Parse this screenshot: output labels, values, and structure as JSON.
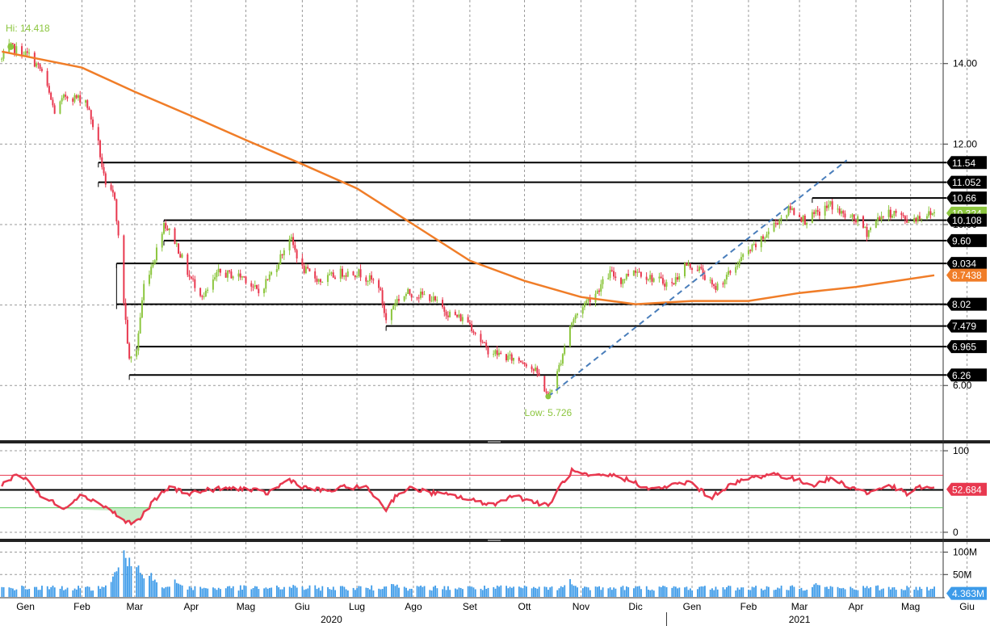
{
  "chart_data": [
    {
      "type": "candlestick",
      "panel": "price",
      "x_start": "2020-01-02",
      "x_end": "2021-05-28",
      "y_ticks": [
        "14.00",
        "12.00",
        "10.00",
        "8.00",
        "6.00"
      ],
      "ylim": [
        4.7,
        15.4
      ],
      "high": {
        "label": "Hi: 14.418",
        "date": "2020-01-06",
        "value": 14.418
      },
      "low": {
        "label": "Low: 5.726",
        "date": "2020-10-28",
        "value": 5.726
      },
      "path": [
        [
          "2020-01-02",
          14.1
        ],
        [
          "2020-01-06",
          14.42
        ],
        [
          "2020-01-17",
          14.2
        ],
        [
          "2020-01-24",
          13.8
        ],
        [
          "2020-01-31",
          12.8
        ],
        [
          "2020-02-06",
          13.2
        ],
        [
          "2020-02-17",
          13.1
        ],
        [
          "2020-02-24",
          12.0
        ],
        [
          "2020-02-28",
          10.9
        ],
        [
          "2020-03-04",
          10.7
        ],
        [
          "2020-03-09",
          8.1
        ],
        [
          "2020-03-12",
          6.6
        ],
        [
          "2020-03-16",
          6.9
        ],
        [
          "2020-03-20",
          8.5
        ],
        [
          "2020-03-26",
          9.2
        ],
        [
          "2020-03-31",
          10.05
        ],
        [
          "2020-04-06",
          9.6
        ],
        [
          "2020-04-14",
          8.7
        ],
        [
          "2020-04-22",
          8.2
        ],
        [
          "2020-04-30",
          8.8
        ],
        [
          "2020-05-14",
          8.7
        ],
        [
          "2020-05-22",
          8.3
        ],
        [
          "2020-06-01",
          9.0
        ],
        [
          "2020-06-08",
          9.7
        ],
        [
          "2020-06-15",
          8.9
        ],
        [
          "2020-06-25",
          8.6
        ],
        [
          "2020-07-06",
          8.8
        ],
        [
          "2020-07-16",
          8.8
        ],
        [
          "2020-07-27",
          8.5
        ],
        [
          "2020-07-31",
          7.6
        ],
        [
          "2020-08-05",
          8.1
        ],
        [
          "2020-08-12",
          8.3
        ],
        [
          "2020-08-24",
          8.2
        ],
        [
          "2020-09-03",
          7.8
        ],
        [
          "2020-09-14",
          7.6
        ],
        [
          "2020-09-24",
          6.9
        ],
        [
          "2020-10-05",
          6.7
        ],
        [
          "2020-10-15",
          6.6
        ],
        [
          "2020-10-22",
          6.3
        ],
        [
          "2020-10-28",
          5.73
        ],
        [
          "2020-11-02",
          6.3
        ],
        [
          "2020-11-09",
          7.5
        ],
        [
          "2020-11-16",
          8.0
        ],
        [
          "2020-11-23",
          8.3
        ],
        [
          "2020-12-01",
          8.8
        ],
        [
          "2020-12-07",
          8.6
        ],
        [
          "2020-12-14",
          8.9
        ],
        [
          "2020-12-22",
          8.7
        ],
        [
          "2021-01-04",
          8.5
        ],
        [
          "2021-01-11",
          9.0
        ],
        [
          "2021-01-19",
          8.9
        ],
        [
          "2021-01-27",
          8.4
        ],
        [
          "2021-02-03",
          8.7
        ],
        [
          "2021-02-12",
          9.2
        ],
        [
          "2021-02-22",
          9.6
        ],
        [
          "2021-03-01",
          10.0
        ],
        [
          "2021-03-10",
          10.4
        ],
        [
          "2021-03-18",
          10.1
        ],
        [
          "2021-03-26",
          10.3
        ],
        [
          "2021-04-01",
          10.5
        ],
        [
          "2021-04-09",
          10.2
        ],
        [
          "2021-04-16",
          10.1
        ],
        [
          "2021-04-21",
          9.8
        ],
        [
          "2021-04-28",
          10.2
        ],
        [
          "2021-05-06",
          10.3
        ],
        [
          "2021-05-13",
          10.1
        ],
        [
          "2021-05-20",
          10.2
        ],
        [
          "2021-05-28",
          10.3
        ]
      ],
      "moving_average": [
        [
          "2020-01-02",
          14.3
        ],
        [
          "2020-02-15",
          13.9
        ],
        [
          "2020-03-15",
          13.3
        ],
        [
          "2020-04-15",
          12.7
        ],
        [
          "2020-05-15",
          12.1
        ],
        [
          "2020-06-15",
          11.5
        ],
        [
          "2020-07-15",
          10.9
        ],
        [
          "2020-08-15",
          10.0
        ],
        [
          "2020-09-15",
          9.1
        ],
        [
          "2020-10-15",
          8.6
        ],
        [
          "2020-11-15",
          8.2
        ],
        [
          "2020-12-15",
          8.02
        ],
        [
          "2021-01-15",
          8.1
        ],
        [
          "2021-02-15",
          8.1
        ],
        [
          "2021-03-15",
          8.3
        ],
        [
          "2021-04-15",
          8.45
        ],
        [
          "2021-05-28",
          8.74
        ]
      ],
      "levels": [
        {
          "label": "11.54",
          "value": 11.54,
          "from": "2020-02-24"
        },
        {
          "label": "11.052",
          "value": 11.052,
          "from": "2020-02-24"
        },
        {
          "label": "10.66",
          "value": 10.66,
          "from": "2021-03-22"
        },
        {
          "label": "10.108",
          "value": 10.108,
          "from": "2020-03-31"
        },
        {
          "label": "9.60",
          "value": 9.6,
          "from": "2020-03-31"
        },
        {
          "label": "9.034",
          "value": 9.034,
          "from": "2020-03-05"
        },
        {
          "label": "8.02",
          "value": 8.02,
          "from": "2020-03-05"
        },
        {
          "label": "7.479",
          "value": 7.479,
          "from": "2020-07-31"
        },
        {
          "label": "6.965",
          "value": 6.965,
          "from": "2020-03-16"
        },
        {
          "label": "6.26",
          "value": 6.26,
          "from": "2020-03-12"
        }
      ],
      "trendline": {
        "start": [
          "2020-10-28",
          5.726
        ],
        "end": [
          "2021-04-10",
          11.6
        ]
      },
      "last_price": {
        "label": "10.324",
        "value": 10.324
      },
      "ma_last": {
        "label": "8.7438",
        "value": 8.7438
      },
      "colors": {
        "up": "#8cc63f",
        "down": "#e8384f",
        "moving_average": "#f07d28",
        "trendline": "#4a7ebb",
        "level_line": "#000000",
        "last_price": "#8cc63f",
        "ma_label": "#f07d28"
      }
    },
    {
      "type": "line",
      "panel": "rsi",
      "y_ticks": [
        "100",
        "0"
      ],
      "ylim": [
        -5,
        105
      ],
      "upper_band": 70,
      "lower_band": 30,
      "mid_level": 52,
      "last": {
        "label": "52.684",
        "value": 52.684
      },
      "path": [
        [
          "2020-01-02",
          58
        ],
        [
          "2020-01-09",
          70
        ],
        [
          "2020-01-16",
          66
        ],
        [
          "2020-01-23",
          44
        ],
        [
          "2020-02-06",
          30
        ],
        [
          "2020-02-13",
          45
        ],
        [
          "2020-02-21",
          40
        ],
        [
          "2020-03-03",
          25
        ],
        [
          "2020-03-10",
          12
        ],
        [
          "2020-03-17",
          14
        ],
        [
          "2020-03-26",
          40
        ],
        [
          "2020-04-03",
          55
        ],
        [
          "2020-04-14",
          48
        ],
        [
          "2020-04-28",
          53
        ],
        [
          "2020-05-13",
          54
        ],
        [
          "2020-05-27",
          48
        ],
        [
          "2020-06-08",
          65
        ],
        [
          "2020-06-16",
          55
        ],
        [
          "2020-06-29",
          50
        ],
        [
          "2020-07-10",
          56
        ],
        [
          "2020-07-21",
          54
        ],
        [
          "2020-07-31",
          28
        ],
        [
          "2020-08-06",
          47
        ],
        [
          "2020-08-14",
          54
        ],
        [
          "2020-08-26",
          48
        ],
        [
          "2020-09-08",
          44
        ],
        [
          "2020-09-18",
          38
        ],
        [
          "2020-09-29",
          34
        ],
        [
          "2020-10-08",
          46
        ],
        [
          "2020-10-16",
          40
        ],
        [
          "2020-10-28",
          32
        ],
        [
          "2020-11-04",
          58
        ],
        [
          "2020-11-10",
          75
        ],
        [
          "2020-11-20",
          68
        ],
        [
          "2020-12-02",
          70
        ],
        [
          "2020-12-14",
          62
        ],
        [
          "2020-12-23",
          52
        ],
        [
          "2021-01-05",
          58
        ],
        [
          "2021-01-14",
          62
        ],
        [
          "2021-01-25",
          42
        ],
        [
          "2021-02-03",
          56
        ],
        [
          "2021-02-15",
          66
        ],
        [
          "2021-03-01",
          72
        ],
        [
          "2021-03-12",
          65
        ],
        [
          "2021-03-22",
          58
        ],
        [
          "2021-04-01",
          66
        ],
        [
          "2021-04-13",
          55
        ],
        [
          "2021-04-22",
          48
        ],
        [
          "2021-05-03",
          58
        ],
        [
          "2021-05-13",
          47
        ],
        [
          "2021-05-21",
          56
        ],
        [
          "2021-05-28",
          52.7
        ]
      ],
      "colors": {
        "line": "#e8384f",
        "upper_band": "#e8384f",
        "lower_band": "#5cc85c",
        "oversold_fill": "#c8ecc8"
      }
    },
    {
      "type": "bar",
      "panel": "volume",
      "y_ticks": [
        "100M",
        "50M"
      ],
      "ylim": [
        0,
        110
      ],
      "unit": "M",
      "last": {
        "label": "4.363M",
        "value": 4.363
      },
      "highlight_values": [
        [
          "2020-02-27",
          25
        ],
        [
          "2020-03-02",
          40
        ],
        [
          "2020-03-09",
          110
        ],
        [
          "2020-03-12",
          90
        ],
        [
          "2020-03-16",
          80
        ],
        [
          "2020-03-23",
          60
        ],
        [
          "2020-04-06",
          40
        ],
        [
          "2020-06-10",
          28
        ],
        [
          "2020-08-03",
          38
        ],
        [
          "2020-11-09",
          42
        ],
        [
          "2021-03-24",
          35
        ]
      ],
      "colors": {
        "bars": "#3d9be9"
      }
    }
  ],
  "x_axis": {
    "months": [
      {
        "label": "Gen",
        "date": "2020-01-15"
      },
      {
        "label": "Feb",
        "date": "2020-02-15"
      },
      {
        "label": "Mar",
        "date": "2020-03-15"
      },
      {
        "label": "Apr",
        "date": "2020-04-15"
      },
      {
        "label": "Mag",
        "date": "2020-05-15"
      },
      {
        "label": "Giu",
        "date": "2020-06-15"
      },
      {
        "label": "Lug",
        "date": "2020-07-15"
      },
      {
        "label": "Ago",
        "date": "2020-08-15"
      },
      {
        "label": "Set",
        "date": "2020-09-15"
      },
      {
        "label": "Ott",
        "date": "2020-10-15"
      },
      {
        "label": "Nov",
        "date": "2020-11-15"
      },
      {
        "label": "Dic",
        "date": "2020-12-15"
      },
      {
        "label": "Gen",
        "date": "2021-01-15"
      },
      {
        "label": "Feb",
        "date": "2021-02-15"
      },
      {
        "label": "Mar",
        "date": "2021-03-15"
      },
      {
        "label": "Apr",
        "date": "2021-04-15"
      },
      {
        "label": "Mag",
        "date": "2021-05-15"
      },
      {
        "label": "Giu",
        "date": "2021-06-15"
      }
    ],
    "years": [
      {
        "label": "2020",
        "date": "2020-07-01"
      },
      {
        "label": "2021",
        "date": "2021-03-15"
      }
    ],
    "year_separator": "2021-01-01"
  }
}
